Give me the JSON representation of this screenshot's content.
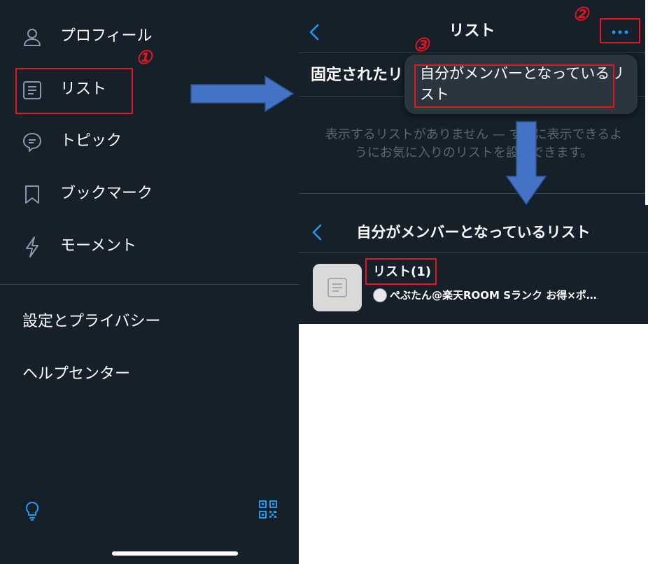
{
  "left_menu": {
    "items": [
      {
        "label": "プロフィール",
        "icon": "person-icon"
      },
      {
        "label": "リスト",
        "icon": "list-icon"
      },
      {
        "label": "トピック",
        "icon": "topic-icon"
      },
      {
        "label": "ブックマーク",
        "icon": "bookmark-icon"
      },
      {
        "label": "モーメント",
        "icon": "lightning-icon"
      }
    ],
    "settings_label": "設定とプライバシー",
    "help_label": "ヘルプセンター",
    "footer_icons": [
      "lightbulb-icon",
      "qr-code-icon"
    ]
  },
  "lists_screen": {
    "title": "リスト",
    "pinned_heading": "固定されたリ",
    "empty_message": "表示するリストがありません — すぐに表示できるようにお気に入りのリストを設定できます。",
    "popup_option": "自分がメンバーとなっているリスト"
  },
  "member_lists_screen": {
    "title": "自分がメンバーとなっているリスト",
    "list": {
      "name": "リスト(1)",
      "owner": "ぺぶたん@楽天ROOM Sランク お得×ポ…"
    }
  },
  "annotations": {
    "step1": "①",
    "step2": "②",
    "step3": "③"
  },
  "colors": {
    "background": "#15202b",
    "accent": "#1d9bf0",
    "highlight": "#e8141e",
    "arrow": "#4472c4"
  }
}
